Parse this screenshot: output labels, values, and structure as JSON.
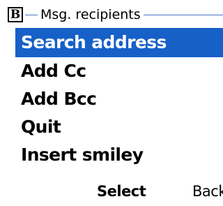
{
  "header": {
    "icon_letter": "B",
    "icon_name": "b-app-icon",
    "title": "Msg. recipients",
    "line_color": "#4a73c6"
  },
  "menu": {
    "selected_color": "#1660c8",
    "items": [
      {
        "label": "Search address",
        "selected": true
      },
      {
        "label": "Add Cc",
        "selected": false
      },
      {
        "label": "Add Bcc",
        "selected": false
      },
      {
        "label": "Quit",
        "selected": false
      },
      {
        "label": "Insert smiley",
        "selected": false
      }
    ]
  },
  "softkeys": {
    "center": "Select",
    "right": "Back"
  }
}
